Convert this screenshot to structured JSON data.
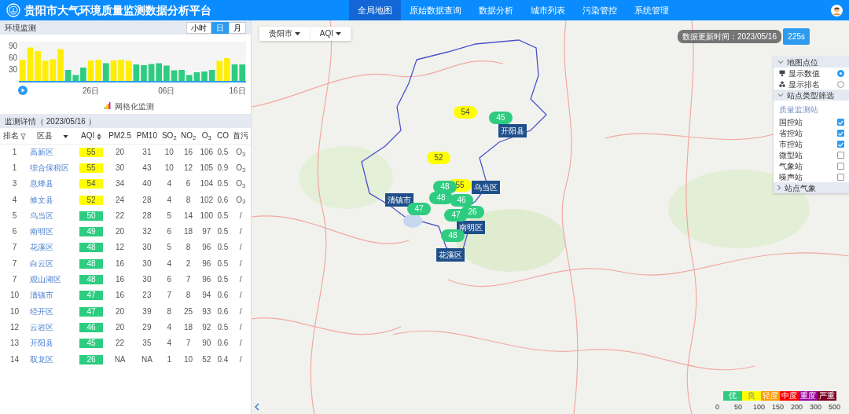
{
  "header": {
    "title": "贵阳市大气环境质量监测数据分析平台",
    "nav": [
      {
        "label": "全局地图",
        "selected": true
      },
      {
        "label": "原始数据查询",
        "selected": false
      },
      {
        "label": "数据分析",
        "selected": false
      },
      {
        "label": "城市列表",
        "selected": false
      },
      {
        "label": "污染管控",
        "selected": false
      },
      {
        "label": "系统管理",
        "selected": false
      }
    ]
  },
  "monitor": {
    "title": "环境监测",
    "periods": [
      {
        "label": "小时",
        "selected": false
      },
      {
        "label": "日",
        "selected": true
      },
      {
        "label": "月",
        "selected": false
      }
    ],
    "chart_data": {
      "type": "bar",
      "categories": [
        null,
        null,
        null,
        null,
        null,
        null,
        null,
        null,
        null,
        "26日",
        null,
        null,
        null,
        null,
        null,
        null,
        null,
        null,
        null,
        "06日",
        null,
        null,
        null,
        null,
        null,
        null,
        null,
        null,
        null,
        "16日"
      ],
      "series": [
        {
          "color": "#ffee00",
          "values": [
            54,
            85,
            76,
            51,
            55,
            81,
            null,
            null,
            null,
            52,
            54,
            null,
            52,
            54,
            51,
            null,
            null,
            null,
            null,
            null,
            null,
            null,
            null,
            null,
            null,
            null,
            51,
            58,
            null,
            null
          ]
        },
        {
          "color": "#2ecc80",
          "values": [
            null,
            null,
            null,
            null,
            null,
            null,
            28,
            15,
            34,
            null,
            null,
            45,
            null,
            null,
            null,
            42,
            40,
            43,
            45,
            39,
            27,
            28,
            15,
            22,
            24,
            28,
            null,
            null,
            42,
            42
          ]
        }
      ],
      "ylim": [
        0,
        100
      ],
      "yticks": [
        30,
        60,
        90
      ]
    },
    "legend": "网格化监测"
  },
  "details": {
    "title": "监测详情（ 2023/05/16 ）",
    "columns": [
      "排名",
      "区县",
      "AQI",
      "PM2.5",
      "PM10",
      "SO$_{2}$",
      "NO$_{2}$",
      "O$_{3}$",
      "CO",
      "首污"
    ],
    "rows": [
      {
        "rank": "1",
        "district": "高新区",
        "aqi": "55",
        "color": "#ffff00",
        "pm25": "20",
        "pm10": "31",
        "so2": "10",
        "no2": "16",
        "o3": "106",
        "co": "0.5",
        "primary": "O$_{3}$"
      },
      {
        "rank": "1",
        "district": "综合保税区",
        "aqi": "55",
        "color": "#ffff00",
        "pm25": "30",
        "pm10": "43",
        "so2": "10",
        "no2": "12",
        "o3": "105",
        "co": "0.9",
        "primary": "O$_{3}$"
      },
      {
        "rank": "3",
        "district": "息烽县",
        "aqi": "54",
        "color": "#ffff00",
        "pm25": "34",
        "pm10": "40",
        "so2": "4",
        "no2": "6",
        "o3": "104",
        "co": "0.5",
        "primary": "O$_{3}$"
      },
      {
        "rank": "4",
        "district": "修文县",
        "aqi": "52",
        "color": "#ffff00",
        "pm25": "24",
        "pm10": "28",
        "so2": "4",
        "no2": "8",
        "o3": "102",
        "co": "0.6",
        "primary": "O$_{3}$"
      },
      {
        "rank": "5",
        "district": "乌当区",
        "aqi": "50",
        "color": "#2ecc80",
        "pm25": "22",
        "pm10": "28",
        "so2": "5",
        "no2": "14",
        "o3": "100",
        "co": "0.5",
        "primary": "/"
      },
      {
        "rank": "6",
        "district": "南明区",
        "aqi": "49",
        "color": "#2ecc80",
        "pm25": "20",
        "pm10": "32",
        "so2": "6",
        "no2": "18",
        "o3": "97",
        "co": "0.5",
        "primary": "/"
      },
      {
        "rank": "7",
        "district": "花溪区",
        "aqi": "48",
        "color": "#2ecc80",
        "pm25": "12",
        "pm10": "30",
        "so2": "5",
        "no2": "8",
        "o3": "96",
        "co": "0.5",
        "primary": "/"
      },
      {
        "rank": "7",
        "district": "白云区",
        "aqi": "48",
        "color": "#2ecc80",
        "pm25": "16",
        "pm10": "30",
        "so2": "4",
        "no2": "2",
        "o3": "96",
        "co": "0.5",
        "primary": "/"
      },
      {
        "rank": "7",
        "district": "观山湖区",
        "aqi": "48",
        "color": "#2ecc80",
        "pm25": "16",
        "pm10": "30",
        "so2": "6",
        "no2": "7",
        "o3": "96",
        "co": "0.5",
        "primary": "/"
      },
      {
        "rank": "10",
        "district": "清镇市",
        "aqi": "47",
        "color": "#2ecc80",
        "pm25": "16",
        "pm10": "23",
        "so2": "7",
        "no2": "8",
        "o3": "94",
        "co": "0.6",
        "primary": "/"
      },
      {
        "rank": "10",
        "district": "经开区",
        "aqi": "47",
        "color": "#2ecc80",
        "pm25": "20",
        "pm10": "39",
        "so2": "8",
        "no2": "25",
        "o3": "93",
        "co": "0.6",
        "primary": "/"
      },
      {
        "rank": "12",
        "district": "云岩区",
        "aqi": "46",
        "color": "#2ecc80",
        "pm25": "20",
        "pm10": "29",
        "so2": "4",
        "no2": "18",
        "o3": "92",
        "co": "0.5",
        "primary": "/"
      },
      {
        "rank": "13",
        "district": "开阳县",
        "aqi": "45",
        "color": "#2ecc80",
        "pm25": "22",
        "pm10": "35",
        "so2": "4",
        "no2": "7",
        "o3": "90",
        "co": "0.6",
        "primary": "/"
      },
      {
        "rank": "14",
        "district": "双龙区",
        "aqi": "26",
        "color": "#2ecc80",
        "pm25": "NA",
        "pm10": "NA",
        "so2": "1",
        "no2": "10",
        "o3": "52",
        "co": "0.4",
        "primary": "/"
      }
    ]
  },
  "map": {
    "dropdowns": [
      "贵阳市",
      "AQI"
    ],
    "update_time": "数据更新时间：2023/05/16",
    "refresh": "225s",
    "markers": [
      {
        "value": "54",
        "color": "#ffff00"
      },
      {
        "value": "45",
        "color": "#2ecc80"
      },
      {
        "value": "52",
        "color": "#ffff00"
      },
      {
        "value": "55",
        "color": "#ffff00"
      },
      {
        "value": "48",
        "color": "#2ecc80"
      },
      {
        "value": "48",
        "color": "#2ecc80"
      },
      {
        "value": "46",
        "color": "#2ecc80"
      },
      {
        "value": "47",
        "color": "#2ecc80"
      },
      {
        "value": "47",
        "color": "#2ecc80"
      },
      {
        "value": "26",
        "color": "#2ecc80"
      },
      {
        "value": "48",
        "color": "#2ecc80"
      }
    ],
    "labels": [
      "开阳县",
      "乌当区",
      "清镇市",
      "南明区",
      "花溪区"
    ],
    "panel": {
      "sections": [
        {
          "title": "地图点位",
          "expanded": true,
          "kind": "radio",
          "items": [
            {
              "label": "显示数值",
              "selected": true
            },
            {
              "label": "显示排名",
              "selected": false
            }
          ]
        },
        {
          "title": "站点类型筛选",
          "expanded": true,
          "kind": "check",
          "group": "质量监测站",
          "items": [
            {
              "label": "国控站",
              "checked": true
            },
            {
              "label": "省控站",
              "checked": true
            },
            {
              "label": "市控站",
              "checked": true
            },
            {
              "label": "微型站",
              "checked": false
            },
            {
              "label": "气象站",
              "checked": false
            },
            {
              "label": "噪声站",
              "checked": false
            }
          ]
        },
        {
          "title": "站点气象",
          "expanded": false
        }
      ]
    },
    "legend": [
      {
        "label": "优",
        "color": "#2ecc80"
      },
      {
        "label": "良",
        "color": "#ffff00"
      },
      {
        "label": "轻度",
        "color": "#ff9900"
      },
      {
        "label": "中度",
        "color": "#ff0000"
      },
      {
        "label": "重度",
        "color": "#99009a"
      },
      {
        "label": "严重",
        "color": "#7e0023"
      }
    ],
    "legend_ticks": [
      "0",
      "50",
      "100",
      "150",
      "200",
      "300",
      "500"
    ]
  }
}
